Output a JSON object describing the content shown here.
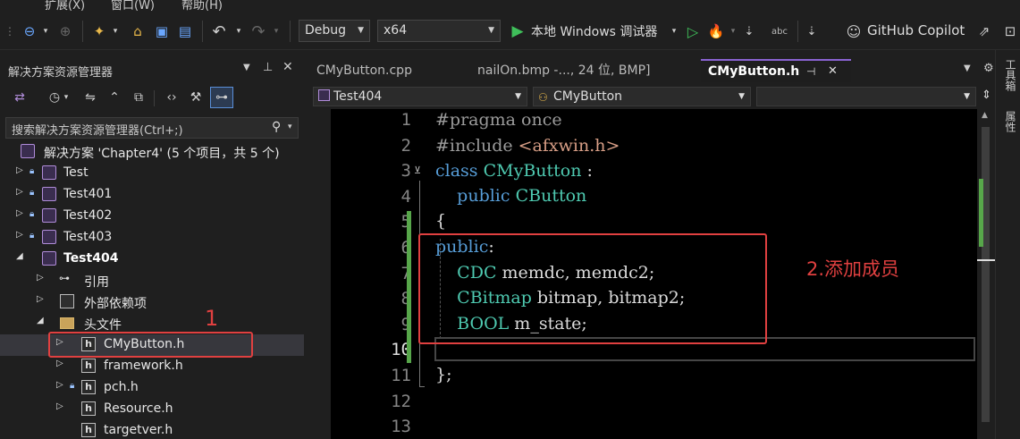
{
  "menu": {
    "items": [
      "扩展(X)",
      "窗口(W)",
      "帮助(H)"
    ]
  },
  "toolbar": {
    "config": "Debug",
    "platform": "x64",
    "run_label": "本地 Windows 调试器",
    "copilot_label": "GitHub Copilot"
  },
  "solution_explorer": {
    "title": "解决方案资源管理器",
    "search_placeholder": "搜索解决方案资源管理器(Ctrl+;)",
    "solution_label": "解决方案 'Chapter4' (5 个项目，共 5 个)",
    "projects": [
      "Test",
      "Test401",
      "Test402",
      "Test403"
    ],
    "active_project": "Test404",
    "references": "引用",
    "external_deps": "外部依赖项",
    "header_folder": "头文件",
    "files": [
      "CMyButton.h",
      "framework.h",
      "pch.h",
      "Resource.h",
      "targetver.h"
    ]
  },
  "editor": {
    "tabs": [
      "CMyButton.cpp",
      "nailOn.bmp -..., 24 位, BMP]",
      "CMyButton.h"
    ],
    "active_tab": "CMyButton.h",
    "nav_project": "Test404",
    "nav_class": "CMyButton",
    "line_numbers": [
      "1",
      "2",
      "3",
      "4",
      "5",
      "6",
      "7",
      "8",
      "9",
      "10",
      "11",
      "12",
      "13"
    ],
    "current_line": "10"
  },
  "annotations": {
    "step1": "1",
    "step2": "2.添加成员"
  },
  "colors": {
    "accent_purple": "#8a63d2",
    "annotation_red": "#e04040",
    "change_bar_green": "#57a64a"
  }
}
